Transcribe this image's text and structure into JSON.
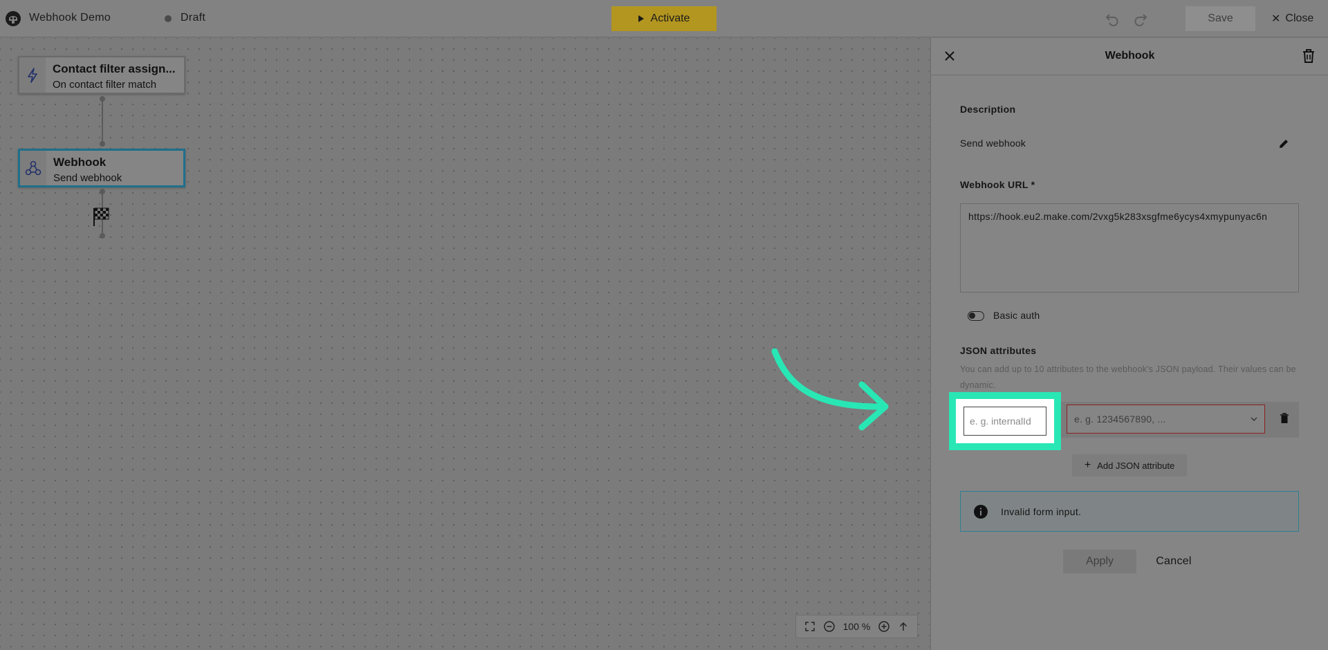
{
  "topbar": {
    "app_title": "Webhook Demo",
    "status": "Draft",
    "activate_label": "Activate",
    "save_label": "Save",
    "close_label": "Close"
  },
  "canvas": {
    "nodes": [
      {
        "title": "Contact filter assign...",
        "subtitle": "On contact filter match",
        "icon": "lightning-icon"
      },
      {
        "title": "Webhook",
        "subtitle": "Send webhook",
        "icon": "webhook-icon"
      }
    ],
    "end_icon": "checkered-flag-icon",
    "zoom": "100 %"
  },
  "panel": {
    "title": "Webhook",
    "description_label": "Description",
    "description_value": "Send webhook",
    "url_label": "Webhook URL *",
    "url_value": "https://hook.eu2.make.com/2vxg5k283xsgfme6ycys4xmypunyac6n",
    "basic_auth_label": "Basic auth",
    "basic_auth_enabled": false,
    "json_label": "JSON attributes",
    "json_hint": "You can add up to 10 attributes to the webhook's JSON payload. Their values can be dynamic.",
    "key_placeholder": "e. g. internalId",
    "value_placeholder": "e. g. 1234567890, ...",
    "add_attr_label": "Add JSON attribute",
    "alert_text": "Invalid form input.",
    "apply_label": "Apply",
    "cancel_label": "Cancel"
  },
  "colors": {
    "highlight": "#29e6b5",
    "activate": "#b39620",
    "selected_node_border": "#1f6f8b",
    "error_border": "#8b2020"
  }
}
